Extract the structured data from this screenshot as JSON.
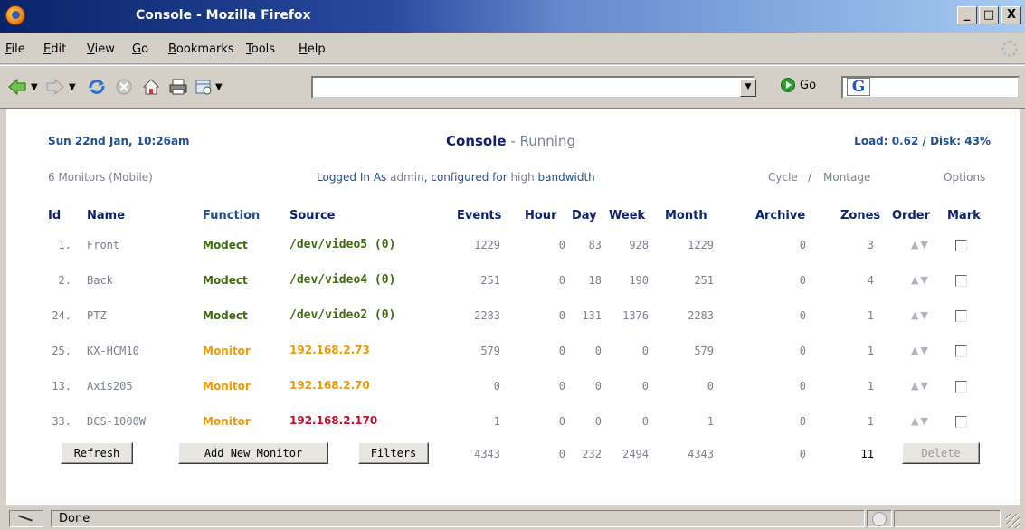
{
  "window": {
    "title": "Console - Mozilla Firefox",
    "min": "_",
    "max": "□",
    "close": "X"
  },
  "menu": [
    "File",
    "Edit",
    "View",
    "Go",
    "Bookmarks",
    "Tools",
    "Help"
  ],
  "toolbar": {
    "url": "",
    "go_label": "Go",
    "search_engine": "G"
  },
  "console": {
    "date": "Sun 22nd Jan, 10:26am",
    "title": "Console",
    "title_separator": " - ",
    "state": "Running",
    "load_label": "Load: 0.62",
    "slash": " / ",
    "disk_label": "Disk: 43%",
    "monitors_summary": "6 Monitors (Mobile)",
    "logged_in_prefix": "Logged In As",
    "user": "admin",
    "configured_for": ", configured for",
    "bandwidth": "high",
    "bandwidth_suffix": "bandwidth",
    "cycle": "Cycle",
    "montage": "Montage",
    "options": "Options"
  },
  "table": {
    "headers": [
      "Id",
      "Name",
      "Function",
      "Source",
      "Events",
      "Hour",
      "Day",
      "Week",
      "Month",
      "Archive",
      "Zones",
      "Order",
      "Mark"
    ],
    "rows": [
      {
        "id": "1.",
        "name": "Front",
        "function": "Modect",
        "source": "/dev/video5 (0)",
        "events": "1229",
        "hour": "0",
        "day": "83",
        "week": "928",
        "month": "1229",
        "archive": "0",
        "zones": "3"
      },
      {
        "id": "2.",
        "name": "Back",
        "function": "Modect",
        "source": "/dev/video4 (0)",
        "events": "251",
        "hour": "0",
        "day": "18",
        "week": "190",
        "month": "251",
        "archive": "0",
        "zones": "4"
      },
      {
        "id": "24.",
        "name": "PTZ",
        "function": "Modect",
        "source": "/dev/video2 (0)",
        "events": "2283",
        "hour": "0",
        "day": "131",
        "week": "1376",
        "month": "2283",
        "archive": "0",
        "zones": "1"
      },
      {
        "id": "25.",
        "name": "KX-HCM10",
        "function": "Monitor",
        "source": "192.168.2.73",
        "events": "579",
        "hour": "0",
        "day": "0",
        "week": "0",
        "month": "579",
        "archive": "0",
        "zones": "1"
      },
      {
        "id": "13.",
        "name": "Axis205",
        "function": "Monitor",
        "source": "192.168.2.70",
        "events": "0",
        "hour": "0",
        "day": "0",
        "week": "0",
        "month": "0",
        "archive": "0",
        "zones": "1"
      },
      {
        "id": "33.",
        "name": "DCS-1000W",
        "function": "Monitor",
        "source": "192.168.2.170",
        "events": "1",
        "hour": "0",
        "day": "0",
        "week": "0",
        "month": "1",
        "archive": "0",
        "zones": "1"
      }
    ],
    "order_glyph": "▲▼",
    "totals": {
      "events": "4343",
      "hour": "0",
      "day": "232",
      "week": "2494",
      "month": "4343",
      "archive": "0",
      "zones": "11"
    },
    "buttons": {
      "refresh": "Refresh",
      "add": "Add New Monitor",
      "filters": "Filters",
      "delete": "Delete"
    }
  },
  "status": {
    "text": "Done"
  },
  "colors": {
    "modect": "#3d6b0d",
    "monitor": "#f09a00",
    "offline_source": "#c0102a",
    "navy": "#0e2170",
    "blue": "#1f4f90",
    "grey": "#7a8092"
  }
}
